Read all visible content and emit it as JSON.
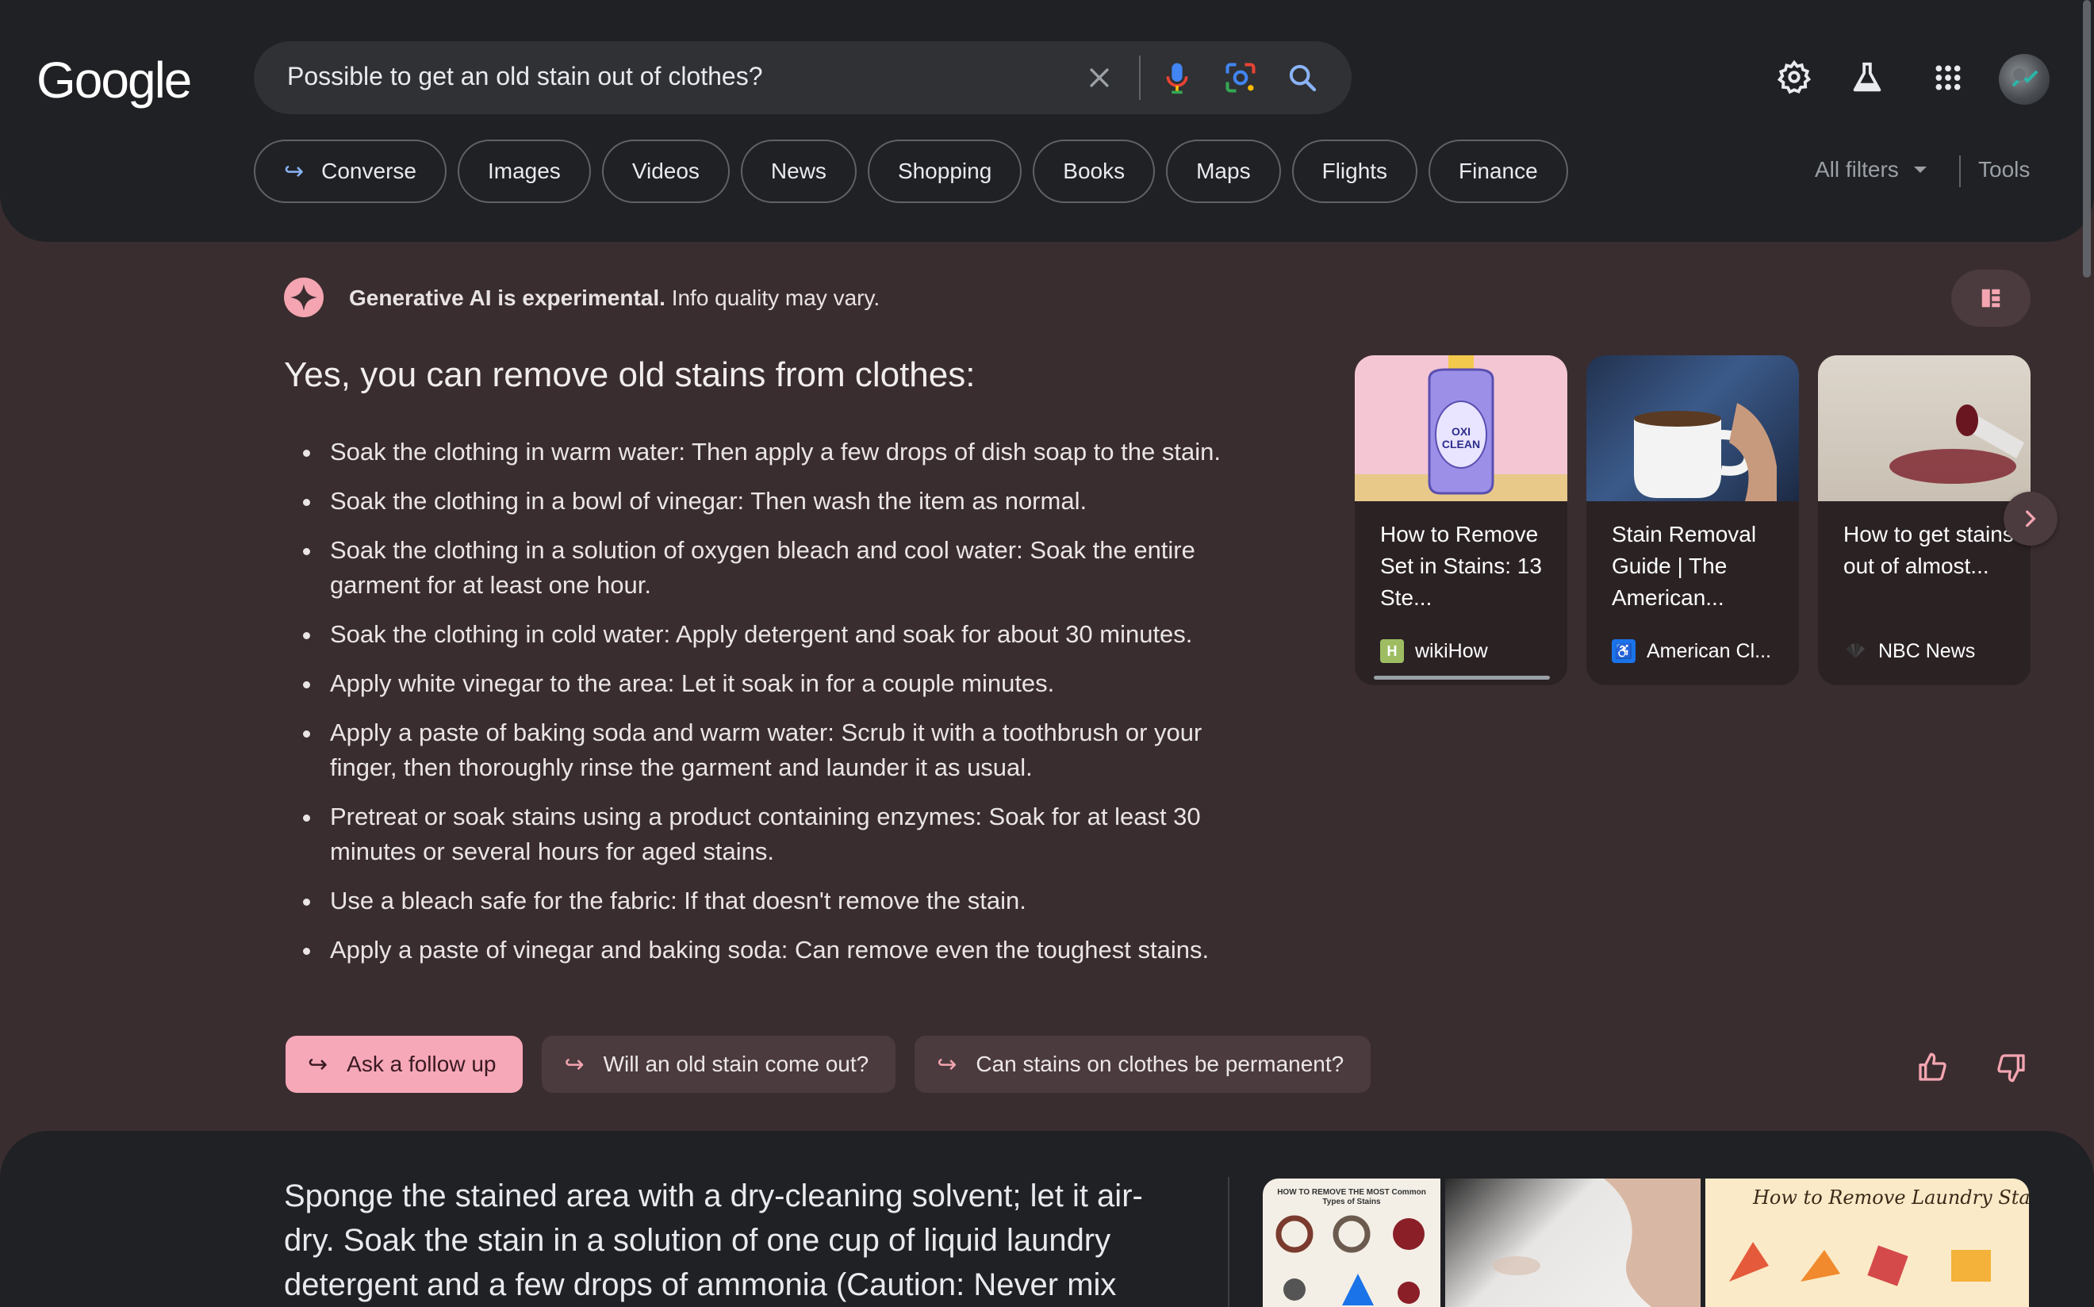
{
  "header": {
    "logo": "Google",
    "search": {
      "value": "Possible to get an old stain out of clothes?"
    },
    "icons": [
      "clear-icon",
      "microphone-icon",
      "lens-icon",
      "search-icon",
      "settings-gear-icon",
      "labs-flask-icon",
      "apps-grid-icon"
    ],
    "tabs": [
      {
        "label": "Converse",
        "has_arrow": true
      },
      {
        "label": "Images"
      },
      {
        "label": "Videos"
      },
      {
        "label": "News"
      },
      {
        "label": "Shopping"
      },
      {
        "label": "Books"
      },
      {
        "label": "Maps"
      },
      {
        "label": "Flights"
      },
      {
        "label": "Finance"
      }
    ],
    "all_filters": "All filters",
    "tools": "Tools"
  },
  "ai": {
    "notice_bold": "Generative AI is experimental.",
    "notice_rest": " Info quality may vary.",
    "heading": "Yes, you can remove old stains from clothes:",
    "items": [
      "Soak the clothing in warm water: Then apply a few drops of dish soap to the stain.",
      "Soak the clothing in a bowl of vinegar: Then wash the item as normal.",
      "Soak the clothing in a solution of oxygen bleach and cool water: Soak the entire garment for at least one hour.",
      "Soak the clothing in cold water: Apply detergent and soak for about 30 minutes.",
      "Apply white vinegar to the area: Let it soak in for a couple minutes.",
      "Apply a paste of baking soda and warm water: Scrub it with a toothbrush or your finger, then thoroughly rinse the garment and launder it as usual.",
      "Pretreat or soak stains using a product containing enzymes: Soak for at least 30 minutes or several hours for aged stains.",
      "Use a bleach safe for the fabric: If that doesn't remove the stain.",
      "Apply a paste of vinegar and baking soda: Can remove even the toughest stains."
    ],
    "cards": [
      {
        "title": "How to Remove Set in Stains: 13 Ste...",
        "source": "wikiHow",
        "image_label": "OXI CLEAN"
      },
      {
        "title": "Stain Removal Guide | The American...",
        "source": "American Cl..."
      },
      {
        "title": "How to get stains out of almost...",
        "source": "NBC News"
      }
    ],
    "followups": [
      {
        "label": "Ask a follow up",
        "primary": true
      },
      {
        "label": "Will an old stain come out?"
      },
      {
        "label": "Can stains on clothes be permanent?"
      }
    ]
  },
  "lower": {
    "text": "Sponge the stained area with a dry-cleaning solvent; let it air-dry. Soak the stain in a solution of one cup of liquid laundry detergent and a few drops of ammonia (Caution: Never mix",
    "image_titles": [
      "HOW TO REMOVE THE MOST Common Types of Stains",
      "How to Remove Laundry Stains"
    ]
  },
  "colors": {
    "header_bg": "#202124",
    "ai_bg": "#3a2d2f",
    "accent_pink": "#f6a8b8",
    "link_blue": "#8ab4f8"
  }
}
